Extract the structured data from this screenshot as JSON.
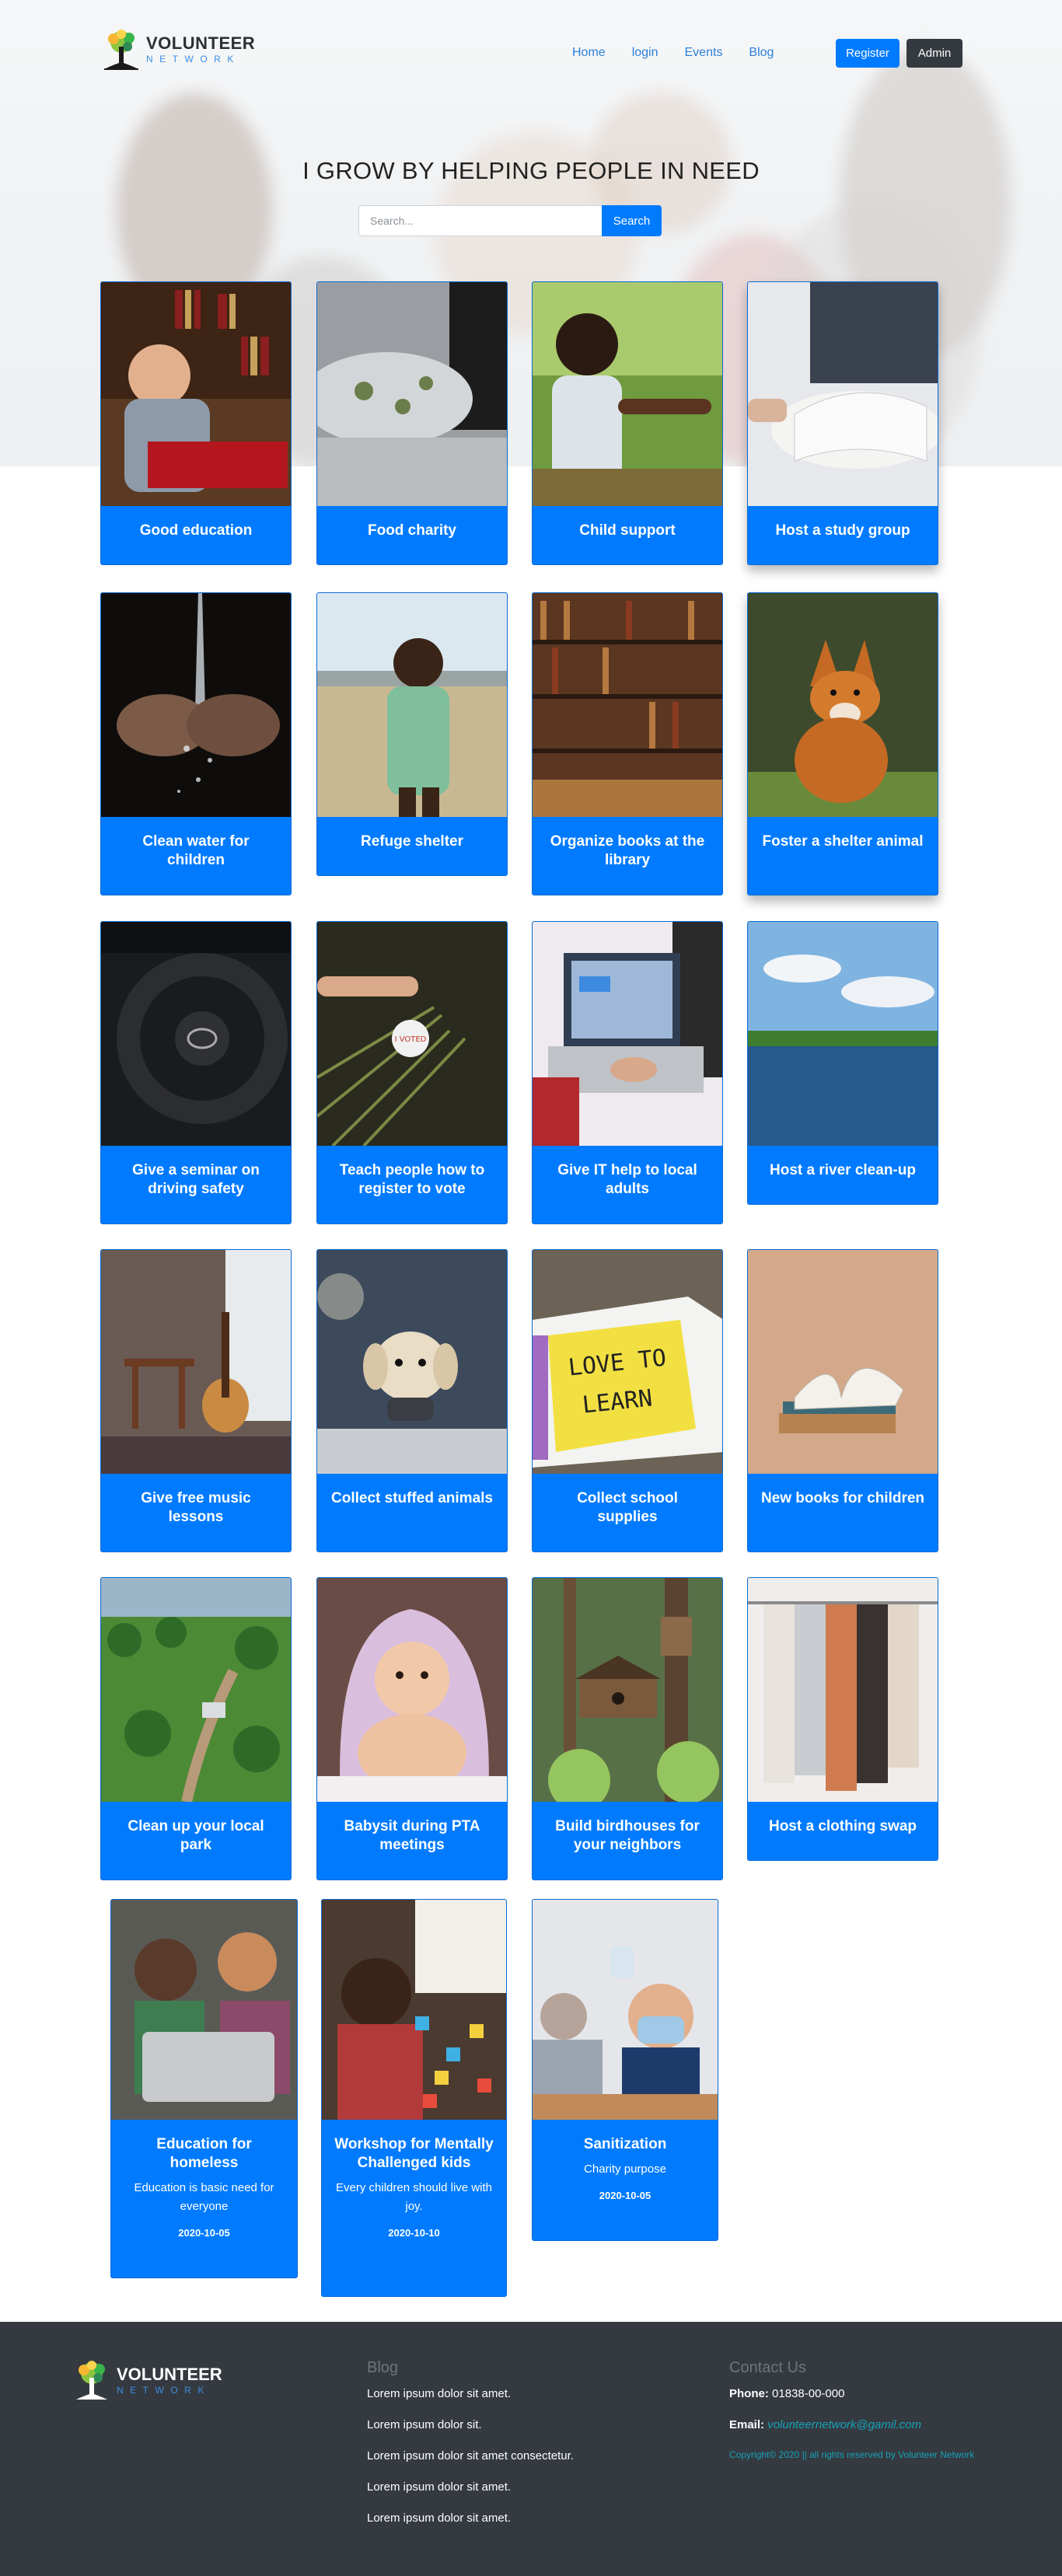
{
  "brand": {
    "name_top": "VOLUNTEER",
    "name_bottom": "NETWORK"
  },
  "nav": {
    "links": [
      "Home",
      "login",
      "Events",
      "Blog"
    ],
    "register_label": "Register",
    "admin_label": "Admin"
  },
  "hero": {
    "title": "I GROW BY HELPING PEOPLE IN NEED",
    "search_placeholder": "Search...",
    "search_button": "Search"
  },
  "cards": [
    {
      "title": "Good education"
    },
    {
      "title": "Food charity"
    },
    {
      "title": "Child support"
    },
    {
      "title": "Host a study group"
    },
    {
      "title": "Clean water for children"
    },
    {
      "title": "Refuge shelter"
    },
    {
      "title": "Organize books at the library"
    },
    {
      "title": "Foster a shelter animal"
    },
    {
      "title": "Give a seminar on driving safety"
    },
    {
      "title": "Teach people how to register to vote"
    },
    {
      "title": "Give IT help to local adults"
    },
    {
      "title": "Host a river clean-up"
    },
    {
      "title": "Give free music lessons"
    },
    {
      "title": "Collect stuffed animals"
    },
    {
      "title": "Collect school supplies"
    },
    {
      "title": "New books for children"
    },
    {
      "title": "Clean up your local park"
    },
    {
      "title": "Babysit during PTA meetings"
    },
    {
      "title": "Build birdhouses for your neighbors"
    },
    {
      "title": "Host a clothing swap"
    }
  ],
  "events": [
    {
      "title": "Education for homeless",
      "description": "Education is basic need for everyone",
      "date": "2020-10-05"
    },
    {
      "title": "Workshop for Mentally Challenged kids",
      "description": "Every children should live with joy.",
      "date": "2020-10-10"
    },
    {
      "title": "Sanitization",
      "description": "Charity purpose",
      "date": "2020-10-05"
    }
  ],
  "footer": {
    "blog_title": "Blog",
    "blog_items": [
      "Lorem ipsum dolor sit amet.",
      "Lorem ipsum dolor sit.",
      "Lorem ipsum dolor sit amet consectetur.",
      "Lorem ipsum dolor sit amet.",
      "Lorem ipsum dolor sit amet."
    ],
    "contact_title": "Contact Us",
    "phone_label": "Phone:",
    "phone": "01838-00-000",
    "email_label": "Email:",
    "email": "volunteernetwork@gamil.com",
    "copyright": "Copyright© 2020 || all rights reserved by Volunteer Network"
  },
  "colors": {
    "primary": "#007bff",
    "dark": "#343a40",
    "link": "#2f7fd6",
    "info": "#17a2b8"
  }
}
